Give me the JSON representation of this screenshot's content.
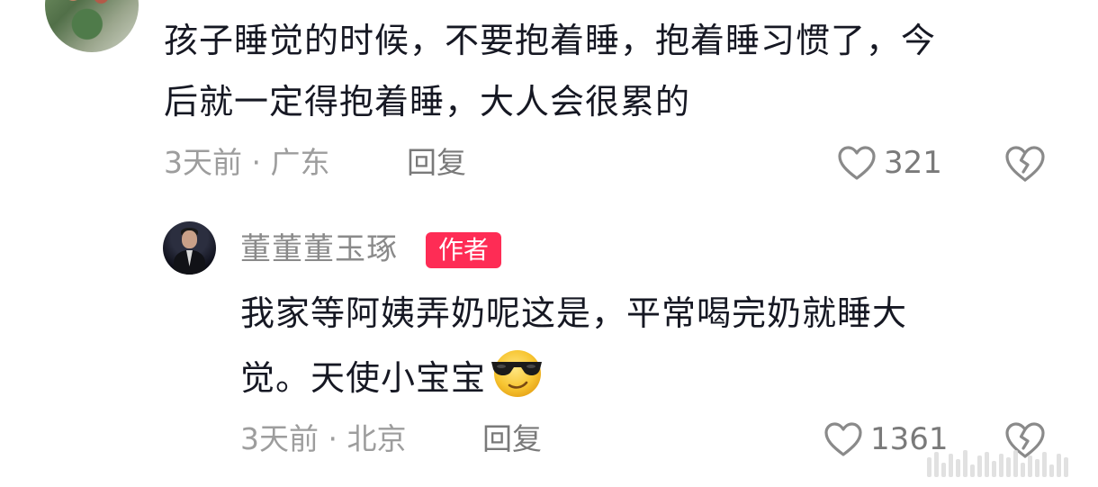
{
  "comments": [
    {
      "text_line1": "孩子睡觉的时候，不要抱着睡，抱着睡习惯了，今",
      "text_line2": "后就一定得抱着睡，大人会很累的",
      "meta": "3天前 · 广东",
      "reply_label": "回复",
      "likes": "321"
    }
  ],
  "author_reply": {
    "username": "董董董玉琢",
    "badge": "作者",
    "text_line1": "我家等阿姨弄奶呢这是，平常喝完奶就睡大",
    "text_line2": "觉。天使小宝宝",
    "emoji": "sunglasses-face-emoji",
    "meta": "3天前 · 北京",
    "reply_label": "回复",
    "likes": "1361"
  },
  "colors": {
    "text": "#161823",
    "meta": "#9d9d9d",
    "badge": "#fe2c55"
  }
}
